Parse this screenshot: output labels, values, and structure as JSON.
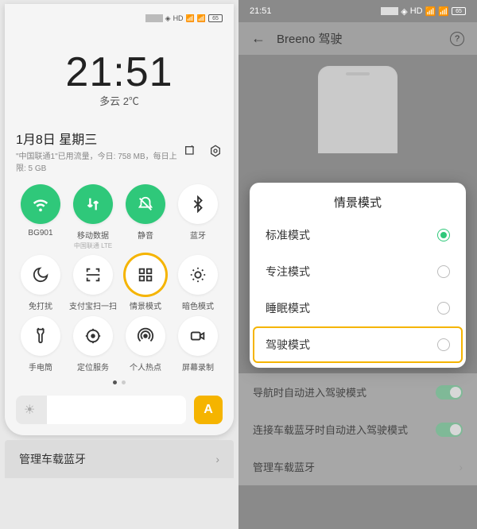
{
  "left": {
    "status": {
      "net": "HD",
      "sig": "₅ᵢₗ ₅ᵢₗ",
      "battery": "65"
    },
    "clock": "21:51",
    "weather": "多云 2℃",
    "date": "1月8日 星期三",
    "data_usage": "\"中国联通1\"已用流量，今日: 758 MB，每日上限: 5 GB",
    "tiles": [
      {
        "label": "BG901",
        "on": true,
        "sub": "",
        "icon": "wifi"
      },
      {
        "label": "移动数据",
        "on": true,
        "sub": "中国联通 LTE",
        "icon": "data"
      },
      {
        "label": "静音",
        "on": true,
        "sub": "",
        "icon": "mute"
      },
      {
        "label": "蓝牙",
        "on": false,
        "sub": "",
        "icon": "bt"
      },
      {
        "label": "免打扰",
        "on": false,
        "sub": "",
        "icon": "dnd"
      },
      {
        "label": "支付宝扫一扫",
        "on": false,
        "sub": "",
        "icon": "scan"
      },
      {
        "label": "情景模式",
        "on": false,
        "sub": "",
        "icon": "scene",
        "hl": true
      },
      {
        "label": "暗色模式",
        "on": false,
        "sub": "",
        "icon": "dark"
      },
      {
        "label": "手电筒",
        "on": false,
        "sub": "",
        "icon": "torch"
      },
      {
        "label": "定位服务",
        "on": false,
        "sub": "",
        "icon": "loc"
      },
      {
        "label": "个人热点",
        "on": false,
        "sub": "",
        "icon": "hotspot"
      },
      {
        "label": "屏幕录制",
        "on": false,
        "sub": "",
        "icon": "rec"
      }
    ],
    "auto": "A",
    "bottom_row": "管理车载蓝牙"
  },
  "right": {
    "status_time": "21:51",
    "status_bat": "65",
    "header": "Breeno 驾驶",
    "modal_title": "情景模式",
    "options": [
      {
        "label": "标准模式",
        "selected": true
      },
      {
        "label": "专注模式",
        "selected": false
      },
      {
        "label": "睡眠模式",
        "selected": false
      },
      {
        "label": "驾驶模式",
        "selected": false,
        "hl": true
      }
    ],
    "settings": [
      "导航时自动进入驾驶模式",
      "连接车载蓝牙时自动进入驾驶模式",
      "管理车载蓝牙"
    ]
  }
}
